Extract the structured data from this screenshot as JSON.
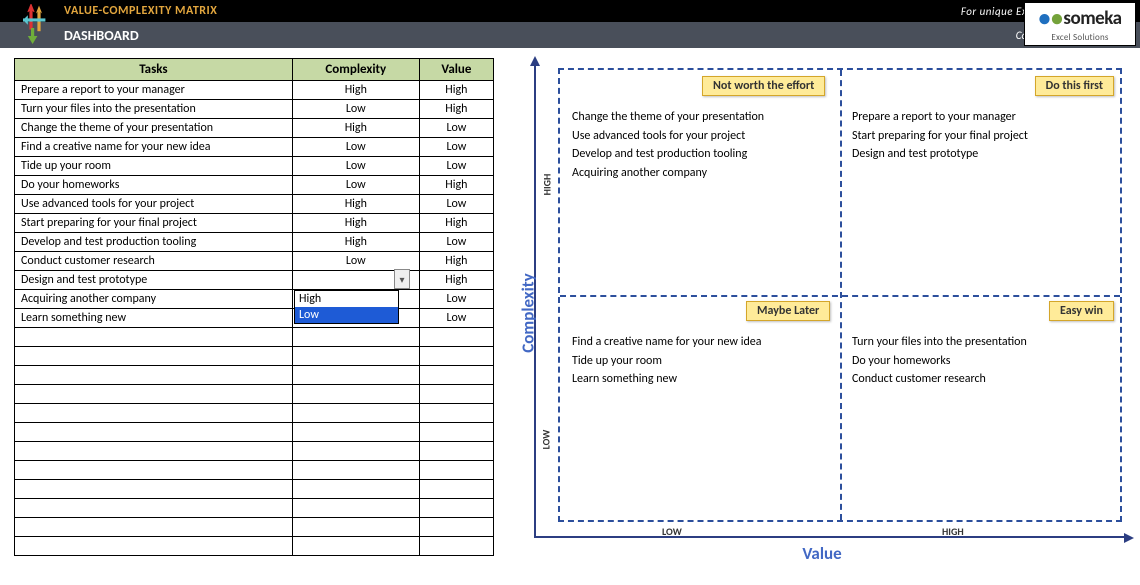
{
  "header": {
    "title": "VALUE-COMPLEXITY MATRIX",
    "promo": "For unique Excel templates, click →",
    "subtitle": "DASHBOARD",
    "contact": "Contact: info@someka.net"
  },
  "brand": {
    "name": "someka",
    "tagline": "Excel Solutions"
  },
  "table": {
    "headers": {
      "tasks": "Tasks",
      "complexity": "Complexity",
      "value": "Value"
    },
    "rows": [
      {
        "task": "Prepare a report to your manager",
        "complexity": "High",
        "value": "High"
      },
      {
        "task": "Turn your files into the presentation",
        "complexity": "Low",
        "value": "High"
      },
      {
        "task": "Change the theme of your presentation",
        "complexity": "High",
        "value": "Low"
      },
      {
        "task": "Find a creative name for your new idea",
        "complexity": "Low",
        "value": "Low"
      },
      {
        "task": "Tide up your room",
        "complexity": "Low",
        "value": "Low"
      },
      {
        "task": "Do your homeworks",
        "complexity": "Low",
        "value": "High"
      },
      {
        "task": "Use advanced tools for your project",
        "complexity": "High",
        "value": "Low"
      },
      {
        "task": "Start preparing for your final project",
        "complexity": "High",
        "value": "High"
      },
      {
        "task": "Develop and test production tooling",
        "complexity": "High",
        "value": "Low"
      },
      {
        "task": "Conduct customer research",
        "complexity": "Low",
        "value": "High"
      },
      {
        "task": "Design and test prototype",
        "complexity": "",
        "value": "High"
      },
      {
        "task": "Acquiring another company",
        "complexity": "High",
        "value": "Low"
      },
      {
        "task": "Learn something new",
        "complexity": "Low",
        "value": "Low"
      }
    ],
    "empty_rows": 12,
    "dropdown": {
      "options": [
        "High",
        "Low"
      ],
      "selected": "Low"
    }
  },
  "matrix": {
    "axis_y": "Complexity",
    "axis_x": "Value",
    "tick_low": "LOW",
    "tick_high": "HIGH",
    "quadrants": {
      "top_left": {
        "badge": "Not worth the effort",
        "items": [
          "Change the theme of your presentation",
          "Use advanced tools for your project",
          "Develop and test production tooling",
          "Acquiring another company"
        ]
      },
      "top_right": {
        "badge": "Do this first",
        "items": [
          "Prepare a report to your manager",
          "Start preparing for your final project",
          "Design and test prototype"
        ]
      },
      "bot_left": {
        "badge": "Maybe Later",
        "items": [
          "Find a creative name for your new idea",
          "Tide up your room",
          "Learn something new"
        ]
      },
      "bot_right": {
        "badge": "Easy win",
        "items": [
          "Turn your files into the presentation",
          "Do your homeworks",
          "Conduct customer research"
        ]
      }
    }
  },
  "chart_data": {
    "type": "table",
    "title": "Value-Complexity Matrix",
    "xlabel": "Value",
    "ylabel": "Complexity",
    "x_categories": [
      "Low",
      "High"
    ],
    "y_categories": [
      "Low",
      "High"
    ],
    "series": [
      {
        "name": "Not worth the effort",
        "complexity": "High",
        "value": "Low",
        "tasks": [
          "Change the theme of your presentation",
          "Use advanced tools for your project",
          "Develop and test production tooling",
          "Acquiring another company"
        ]
      },
      {
        "name": "Do this first",
        "complexity": "High",
        "value": "High",
        "tasks": [
          "Prepare a report to your manager",
          "Start preparing for your final project",
          "Design and test prototype"
        ]
      },
      {
        "name": "Maybe Later",
        "complexity": "Low",
        "value": "Low",
        "tasks": [
          "Find a creative name for your new idea",
          "Tide up your room",
          "Learn something new"
        ]
      },
      {
        "name": "Easy win",
        "complexity": "Low",
        "value": "High",
        "tasks": [
          "Turn your files into the presentation",
          "Do your homeworks",
          "Conduct customer research"
        ]
      }
    ]
  }
}
